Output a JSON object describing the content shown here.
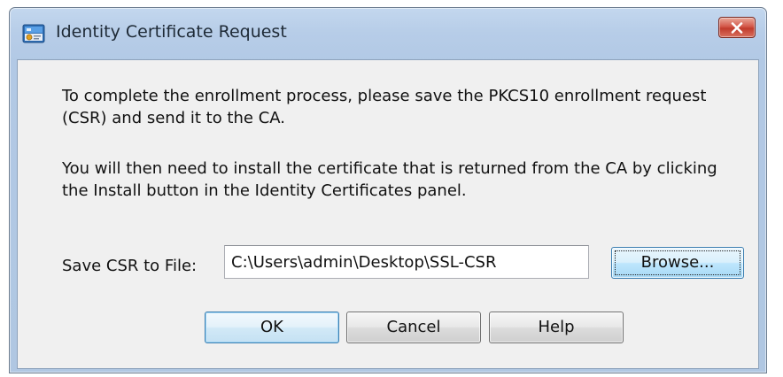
{
  "window": {
    "title": "Identity Certificate Request",
    "close_glyph": "✕"
  },
  "message": {
    "line1": "To complete the enrollment process, please save the PKCS10 enrollment request (CSR) and send it to the CA.",
    "line2": "You will then need to install the certificate that is returned from the CA by clicking the Install button in the Identity Certificates panel."
  },
  "save_csr": {
    "label": "Save CSR to File:",
    "value": "C:\\Users\\admin\\Desktop\\SSL-CSR",
    "browse_label": "Browse..."
  },
  "buttons": {
    "ok": "OK",
    "cancel": "Cancel",
    "help": "Help"
  },
  "icons": {
    "app": "certificate-app-icon",
    "close": "close-icon"
  },
  "colors": {
    "titlebar": "#b7cde8",
    "client_background": "#f0f0f0",
    "close_button": "#c13b2c",
    "focus_button_border": "#3c7fb1"
  }
}
